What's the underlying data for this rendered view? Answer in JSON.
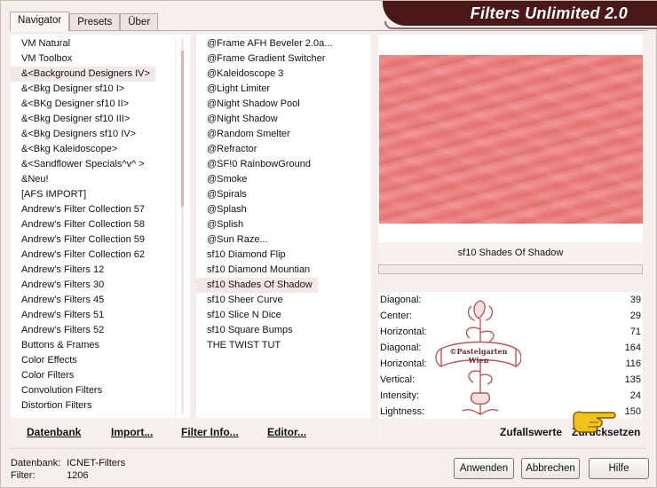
{
  "tabs": [
    {
      "label": "Navigator"
    },
    {
      "label": "Presets"
    },
    {
      "label": "Über"
    }
  ],
  "app_title": "Filters Unlimited 2.0",
  "categories": [
    "VM Natural",
    "VM Toolbox",
    "&<Background Designers IV>",
    "&<Bkg Designer sf10 I>",
    "&<BKg Designer sf10 II>",
    "&<Bkg Designer sf10 III>",
    "&<Bkg Designers sf10 IV>",
    "&<Bkg Kaleidoscope>",
    "&<Sandflower Specials^v^ >",
    "&Neu!",
    "[AFS IMPORT]",
    "Andrew's Filter Collection 57",
    "Andrew's Filter Collection 58",
    "Andrew's Filter Collection 59",
    "Andrew's Filter Collection 62",
    "Andrew's Filters 12",
    "Andrew's Filters 30",
    "Andrew's Filters 45",
    "Andrew's Filters 51",
    "Andrew's Filters 52",
    "Buttons & Frames",
    "Color Effects",
    "Color Filters",
    "Convolution Filters",
    "Distortion Filters"
  ],
  "selected_category_index": 2,
  "filters": [
    "@Frame AFH Beveler 2.0a...",
    "@Frame Gradient Switcher",
    "@Kaleidoscope 3",
    "@Light Limiter",
    "@Night Shadow Pool",
    "@Night Shadow",
    "@Random Smelter",
    "@Refractor",
    "@SF!0 RainbowGround",
    "@Smoke",
    "@Spirals",
    "@Splash",
    "@Splish",
    "@Sun Raze...",
    "sf10 Diamond Flip",
    "sf10 Diamond Mountian",
    "sf10 Shades Of Shadow",
    "sf10 Sheer Curve",
    "sf10 Slice N Dice",
    "sf10 Square Bumps",
    "THE TWIST TUT"
  ],
  "selected_filter_index": 16,
  "preview": {
    "filter_name": "sf10 Shades Of Shadow",
    "progress": 0
  },
  "params": [
    {
      "label": "Diagonal:",
      "value": "39"
    },
    {
      "label": "Center:",
      "value": "29"
    },
    {
      "label": "Horizontal:",
      "value": "71"
    },
    {
      "label": "Diagonal:",
      "value": "164"
    },
    {
      "label": "Horizontal:",
      "value": "116"
    },
    {
      "label": "Vertical:",
      "value": "135"
    },
    {
      "label": "Intensity:",
      "value": "24"
    },
    {
      "label": "Lightness:",
      "value": "150"
    }
  ],
  "watermark_text": {
    "line1": "©Pastelgarten",
    "line2": "Wien"
  },
  "toolbar": {
    "datenbank": "Datenbank",
    "import": "Import...",
    "filter_info": "Filter Info...",
    "editor": "Editor...",
    "zufallswerte": "Zufallswerte",
    "zuruecksetzen": "Zurücksetzen"
  },
  "status": {
    "datenbank_label": "Datenbank:",
    "datenbank_value": "ICNET-Filters",
    "filter_label": "Filter:",
    "filter_value": "1206"
  },
  "buttons": {
    "apply": "Anwenden",
    "cancel": "Abbrechen",
    "help": "Hilfe"
  },
  "colors": {
    "accent": "#4a1818",
    "preview": "#ec8484",
    "background": "#f6eded"
  }
}
